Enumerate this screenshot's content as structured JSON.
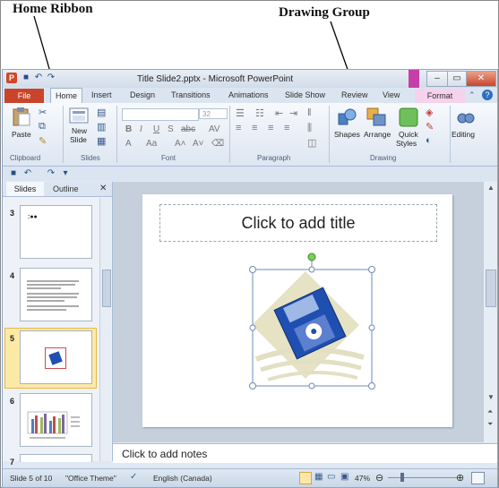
{
  "callouts": {
    "home_ribbon": "Home Ribbon",
    "drawing_group": "Drawing Group"
  },
  "window": {
    "title": "Title Slide2.pptx - Microsoft PowerPoint",
    "app_icon": "P"
  },
  "tabs": [
    "File",
    "Home",
    "Insert",
    "Design",
    "Transitions",
    "Animations",
    "Slide Show",
    "Review",
    "View",
    "Format"
  ],
  "ribbon": {
    "clipboard": {
      "paste": "Paste",
      "label": "Clipboard"
    },
    "slides": {
      "new_slide_1": "New",
      "new_slide_2": "Slide",
      "label": "Slides"
    },
    "font": {
      "size": "32",
      "label": "Font"
    },
    "paragraph": {
      "label": "Paragraph"
    },
    "drawing": {
      "shapes": "Shapes",
      "arrange": "Arrange",
      "quick_styles_1": "Quick",
      "quick_styles_2": "Styles",
      "label": "Drawing"
    },
    "editing": {
      "label": "Editing"
    }
  },
  "pane_tabs": {
    "slides": "Slides",
    "outline": "Outline"
  },
  "thumbnails": [
    {
      "num": "3"
    },
    {
      "num": "4"
    },
    {
      "num": "5"
    },
    {
      "num": "6"
    },
    {
      "num": "7"
    }
  ],
  "slide": {
    "title_placeholder": "Click to add title"
  },
  "notes": {
    "placeholder": "Click to add notes"
  },
  "status": {
    "slide_info": "Slide 5 of 10",
    "theme": "\"Office Theme\"",
    "language": "English (Canada)",
    "zoom": "47%"
  },
  "colors": {
    "file_tab": "#c8452b",
    "format_tab": "#f6d2ec",
    "floppy": "#1f4fb0",
    "diamond": "#e6e2c4"
  }
}
